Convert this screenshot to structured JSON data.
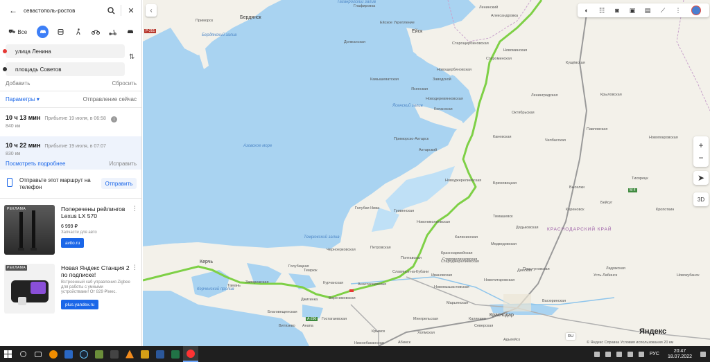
{
  "search": {
    "query": "севастополь-ростов"
  },
  "modes": {
    "all_label": "Все"
  },
  "waypoints": {
    "from": "улица Ленина",
    "to": "площадь Советов"
  },
  "actions": {
    "add": "Добавить",
    "reset": "Сбросить"
  },
  "params": {
    "label": "Параметры",
    "departure": "Отправление сейчас"
  },
  "routes": [
    {
      "time": "10 ч 13 мин",
      "arrival": "Прибытие 19 июля, в 06:58",
      "distance": "840 км"
    },
    {
      "time": "10 ч 22 мин",
      "arrival": "Прибытие 19 июля, в 07:07",
      "distance": "830 км",
      "details": "Посмотреть подробнее",
      "fix": "Исправить"
    }
  ],
  "send": {
    "text": "Отправьте этот маршрут на телефон",
    "button": "Отправить"
  },
  "ads": [
    {
      "tag": "РЕКЛАМА",
      "title": "Поперечены рейлингов Lexus LX 570",
      "price": "6 999 ₽",
      "desc": "Запчасти для авто",
      "button": "avito.ru"
    },
    {
      "tag": "РЕКЛАМА",
      "title": "Новая Яндекс Станция 2 по подписке!",
      "desc": "Встроенный хаб управления Zigbee для работы с умными устройствами! От 829 ₽/мес.",
      "button": "plus.yandex.ru"
    }
  ],
  "map": {
    "labels": {
      "azov_sea": "Азовское море",
      "berdyansk_bay": "Бердянский залив",
      "yasensky_bay": "Ясенский залив",
      "temryuk_bay": "Темрюкский залив",
      "taganrog_bay": "Таганрогский залив",
      "kerch_strait": "Керченский пролив",
      "krasnodar_krai": "КРАСНОДАРСКИЙ КРАЙ",
      "berdyansk": "Бердянск",
      "primorsk": "Приморск",
      "kerch": "Керчь",
      "krasnodar": "Краснодар",
      "yeysk": "Ейск",
      "primorsko_akhtarsk": "Приморско-Ахтарск",
      "slavyansk": "Славянск-на-Кубани",
      "temryuk": "Темрюк",
      "anapa": "Анапа",
      "krymsk": "Крымск",
      "timashevsk": "Тимашевск",
      "kanevskaya": "Каневская",
      "starominskaya": "Староминская",
      "novominskaya": "Новоминская",
      "pavlovskaya": "Павловская",
      "kushchevskaya": "Кущёвская",
      "bryukhovetskaya": "Брюховецкая",
      "korenovsk": "Кореновск",
      "tikhoretsk": "Тихорецк",
      "dinskaya": "Динская",
      "leningradskaya": "Ленинградская",
      "krylovskaya": "Крыловская",
      "oktyabrskaya": "Октябрьская",
      "staroshcherbinovskaya": "Старощербиновская",
      "ust_labinsk": "Усть-Лабинск",
      "ladozhskaya": "Ладожская",
      "kropotkin": "Кропоткин",
      "vyselki": "Выселки",
      "abinsk": "Абинск",
      "poltavskaya": "Полтавская",
      "petrovskaya": "Петровская",
      "grivenskaya": "Гривенская",
      "kalininskaya": "Калининская",
      "medvedovskaya": "Медведовская",
      "dyadkovskaya": "Дядьковская",
      "vasyurinskaya": "Васюринская",
      "plastunovskaya": "Пластуновская",
      "dolzhanskaya": "Должанская",
      "glafirovka": "Глафировка",
      "akhtarsky": "Ахтарский",
      "golubaya_niva": "Голубая Нива",
      "chernoerkovskaya": "Черноерковская",
      "kurchanskaya": "Курчанская",
      "varenikovskaya": "Варениковская",
      "gostagaevskaya": "Гостагаевская",
      "kholmskaya": "Холмская",
      "marevka": "Марьянская",
      "severskaya": "Северская",
      "goryachy_klyuch": "Горячий Ключ",
      "adygeysk": "Адыгейск",
      "novokubansk": "Новокубанск",
      "beisug": "Бейсуг",
      "novopokrovskaya": "Новопокровская",
      "zavodskoy": "Заводской",
      "kamyshevatskaya": "Камышеватская",
      "novoderevyankovskaya": "Новодеревянковская",
      "kopanskaya": "Копанская",
      "yasenskaya": "Ясенская",
      "novoshcherbinovskaya": "Новощербиновская",
      "yeyskoye_ukreplenie": "Ейское Укрепление",
      "novodzhereliyevskaya": "Новоджерелиевская",
      "starodzhereliyevskaya": "Староджерелиевская",
      "krasnoarmeyskaya": "Красноармейская",
      "starovelichkovskaya": "Старовеличковская",
      "novotitarovskaya": "Новотитаровская",
      "novomyshastovskaya": "Новомышастовская",
      "ivanovskaya": "Ивановская",
      "anastasievskaya": "Анастасиевская",
      "taman": "Тамань",
      "zaporozhskaya": "Запорожская",
      "golubitskaya": "Голубицкая",
      "blagoveshchenskaya": "Благовещенская",
      "vityazevo": "Витязево",
      "dzhiginka": "Джигинка",
      "nizhnebakanskaya": "Нижнебаканская",
      "mingrelskaya": "Мингрельская",
      "kalinino": "Калинино",
      "chelbasskaya": "Челбасская",
      "alekseyevka": "Александровка",
      "leninsky": "Ленинский",
      "novonikolaevskaya": "Новониколаевская"
    },
    "roads": {
      "m4": "M-4",
      "a290": "А-290",
      "r251": "Р-251"
    },
    "lang": "RU",
    "logo": "Яндекс",
    "copyright": "© Яндекс  Справка  Условия использования  20 км",
    "zoom_in": "+",
    "zoom_out": "−",
    "mode_3d": "3D"
  },
  "taskbar": {
    "time": "20:47",
    "date": "18.07.2022",
    "lang": "РУС"
  },
  "colors": {
    "route": "#7ed046",
    "accent": "#3d7ff7",
    "water": "#a9d3f1",
    "land": "#f3f1ea"
  }
}
